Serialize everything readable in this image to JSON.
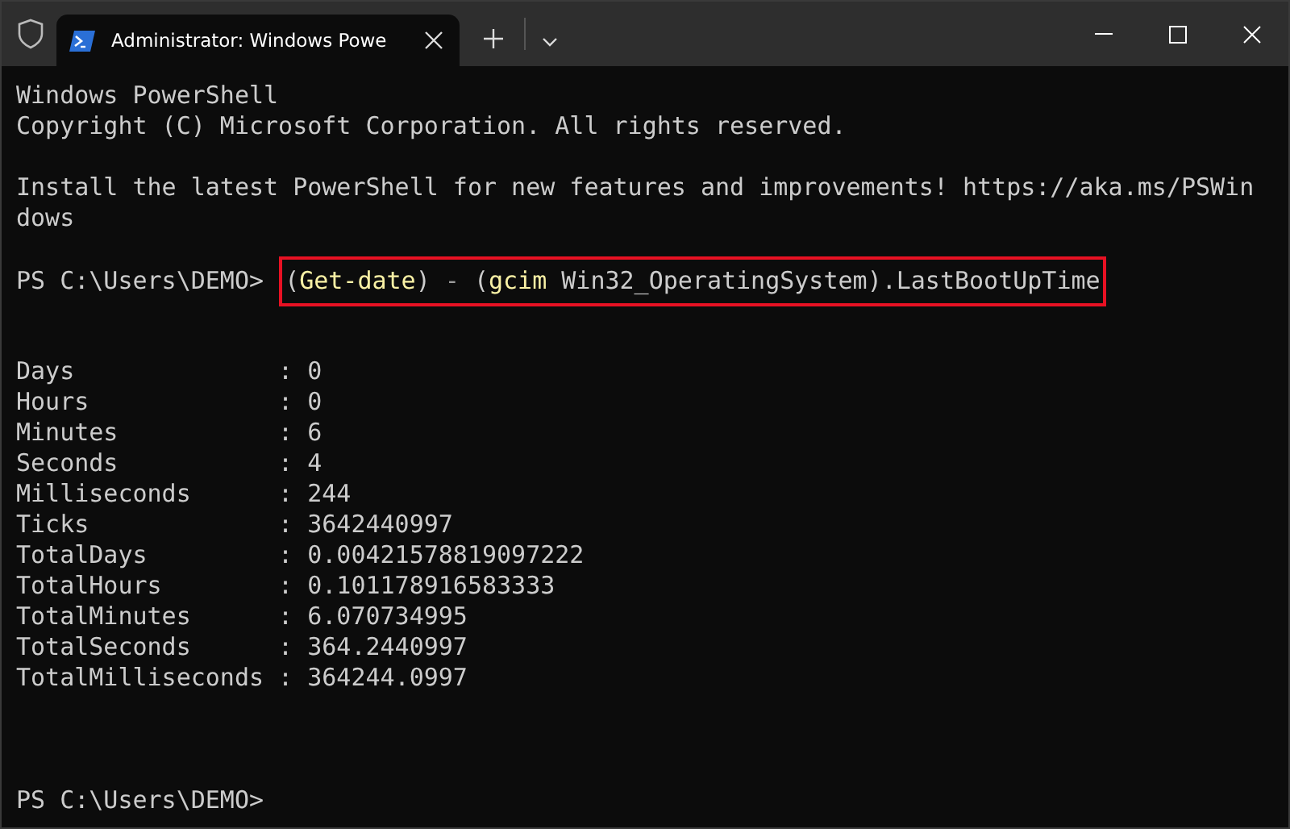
{
  "window": {
    "tab_title": "Administrator: Windows Powe"
  },
  "terminal": {
    "lines": [
      {
        "kind": "text",
        "text": "Windows PowerShell"
      },
      {
        "kind": "text",
        "text": "Copyright (C) Microsoft Corporation. All rights reserved."
      },
      {
        "kind": "blank"
      },
      {
        "kind": "text",
        "text": "Install the latest PowerShell for new features and improvements! https://aka.ms/PSWin"
      },
      {
        "kind": "text",
        "text": "dows"
      },
      {
        "kind": "blank"
      },
      {
        "kind": "command",
        "prompt": "PS C:\\Users\\DEMO>",
        "highlighted": true,
        "tokens": [
          {
            "kind": "plain",
            "text": "("
          },
          {
            "kind": "cmdlet",
            "text": "Get-date"
          },
          {
            "kind": "plain",
            "text": ")"
          },
          {
            "kind": "operator",
            "text": " - "
          },
          {
            "kind": "plain",
            "text": "("
          },
          {
            "kind": "cmdlet",
            "text": "gcim"
          },
          {
            "kind": "argument",
            "text": " Win32_OperatingSystem"
          },
          {
            "kind": "plain",
            "text": ").LastBootUpTime"
          }
        ]
      },
      {
        "kind": "blank"
      },
      {
        "kind": "blank"
      },
      {
        "kind": "text",
        "text": "Days              : 0"
      },
      {
        "kind": "text",
        "text": "Hours             : 0"
      },
      {
        "kind": "text",
        "text": "Minutes           : 6"
      },
      {
        "kind": "text",
        "text": "Seconds           : 4"
      },
      {
        "kind": "text",
        "text": "Milliseconds      : 244"
      },
      {
        "kind": "text",
        "text": "Ticks             : 3642440997"
      },
      {
        "kind": "text",
        "text": "TotalDays         : 0.00421578819097222"
      },
      {
        "kind": "text",
        "text": "TotalHours        : 0.101178916583333"
      },
      {
        "kind": "text",
        "text": "TotalMinutes      : 6.070734995"
      },
      {
        "kind": "text",
        "text": "TotalSeconds      : 364.2440997"
      },
      {
        "kind": "text",
        "text": "TotalMilliseconds : 364244.0997"
      },
      {
        "kind": "blank"
      },
      {
        "kind": "blank"
      },
      {
        "kind": "blank"
      },
      {
        "kind": "prompt",
        "prompt": "PS C:\\Users\\DEMO>"
      }
    ]
  }
}
